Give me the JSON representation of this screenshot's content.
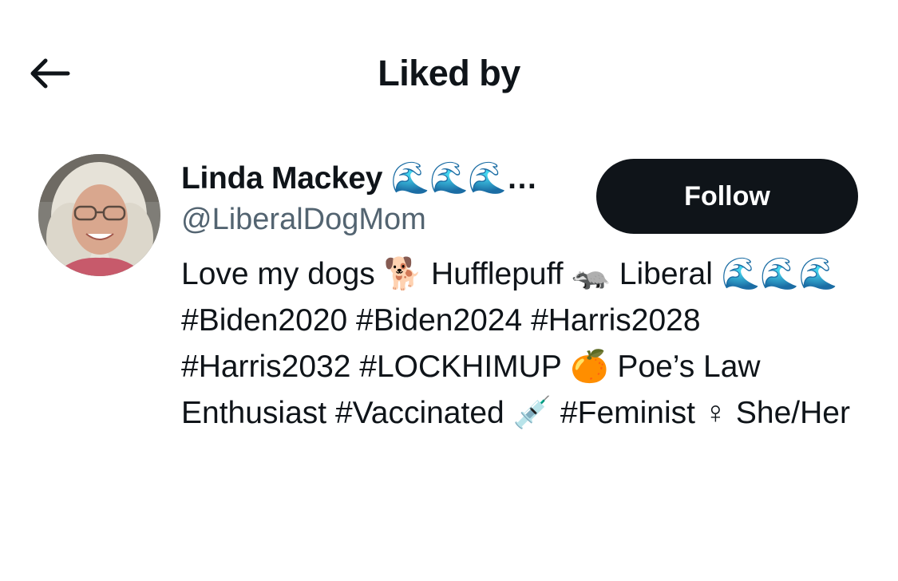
{
  "header": {
    "title": "Liked by",
    "back_icon": "arrow-left-icon"
  },
  "user": {
    "display_name": "Linda Mackey 🌊🌊🌊…",
    "handle": "@LiberalDogMom",
    "follow_label": "Follow",
    "avatar_icon": "profile-photo",
    "bio": "Love my dogs 🐕 Hufflepuff 🦡 Liberal 🌊🌊🌊 #Biden2020 #Biden2024 #Harris2028 #Harris2032 #LOCKHIMUP 🍊 Poe’s Law Enthusiast #Vaccinated 💉 #Feminist ♀ She/Her"
  },
  "colors": {
    "text_primary": "#0f1419",
    "text_secondary": "#536471",
    "button_bg": "#0f1419",
    "button_text": "#ffffff"
  }
}
